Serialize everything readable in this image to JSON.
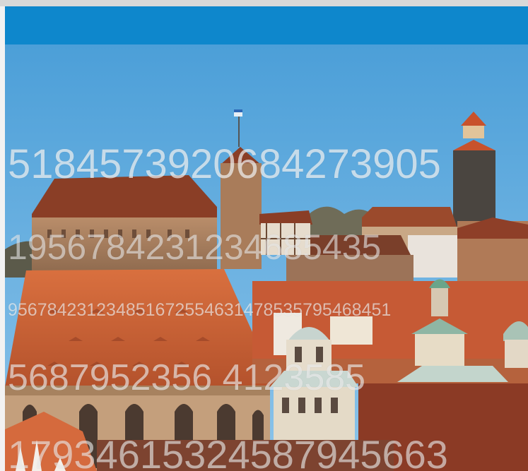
{
  "banner": {
    "color": "#0e87cc"
  },
  "photo": {
    "subject": "castle-cityscape-photo",
    "sky_color": "#57a9de"
  },
  "watermarks": [
    "5184573920684273905",
    "1956784231234685435",
    "956784231234851672554631478535795468451",
    "5687952356    4123585",
    "17934615324587945663"
  ]
}
